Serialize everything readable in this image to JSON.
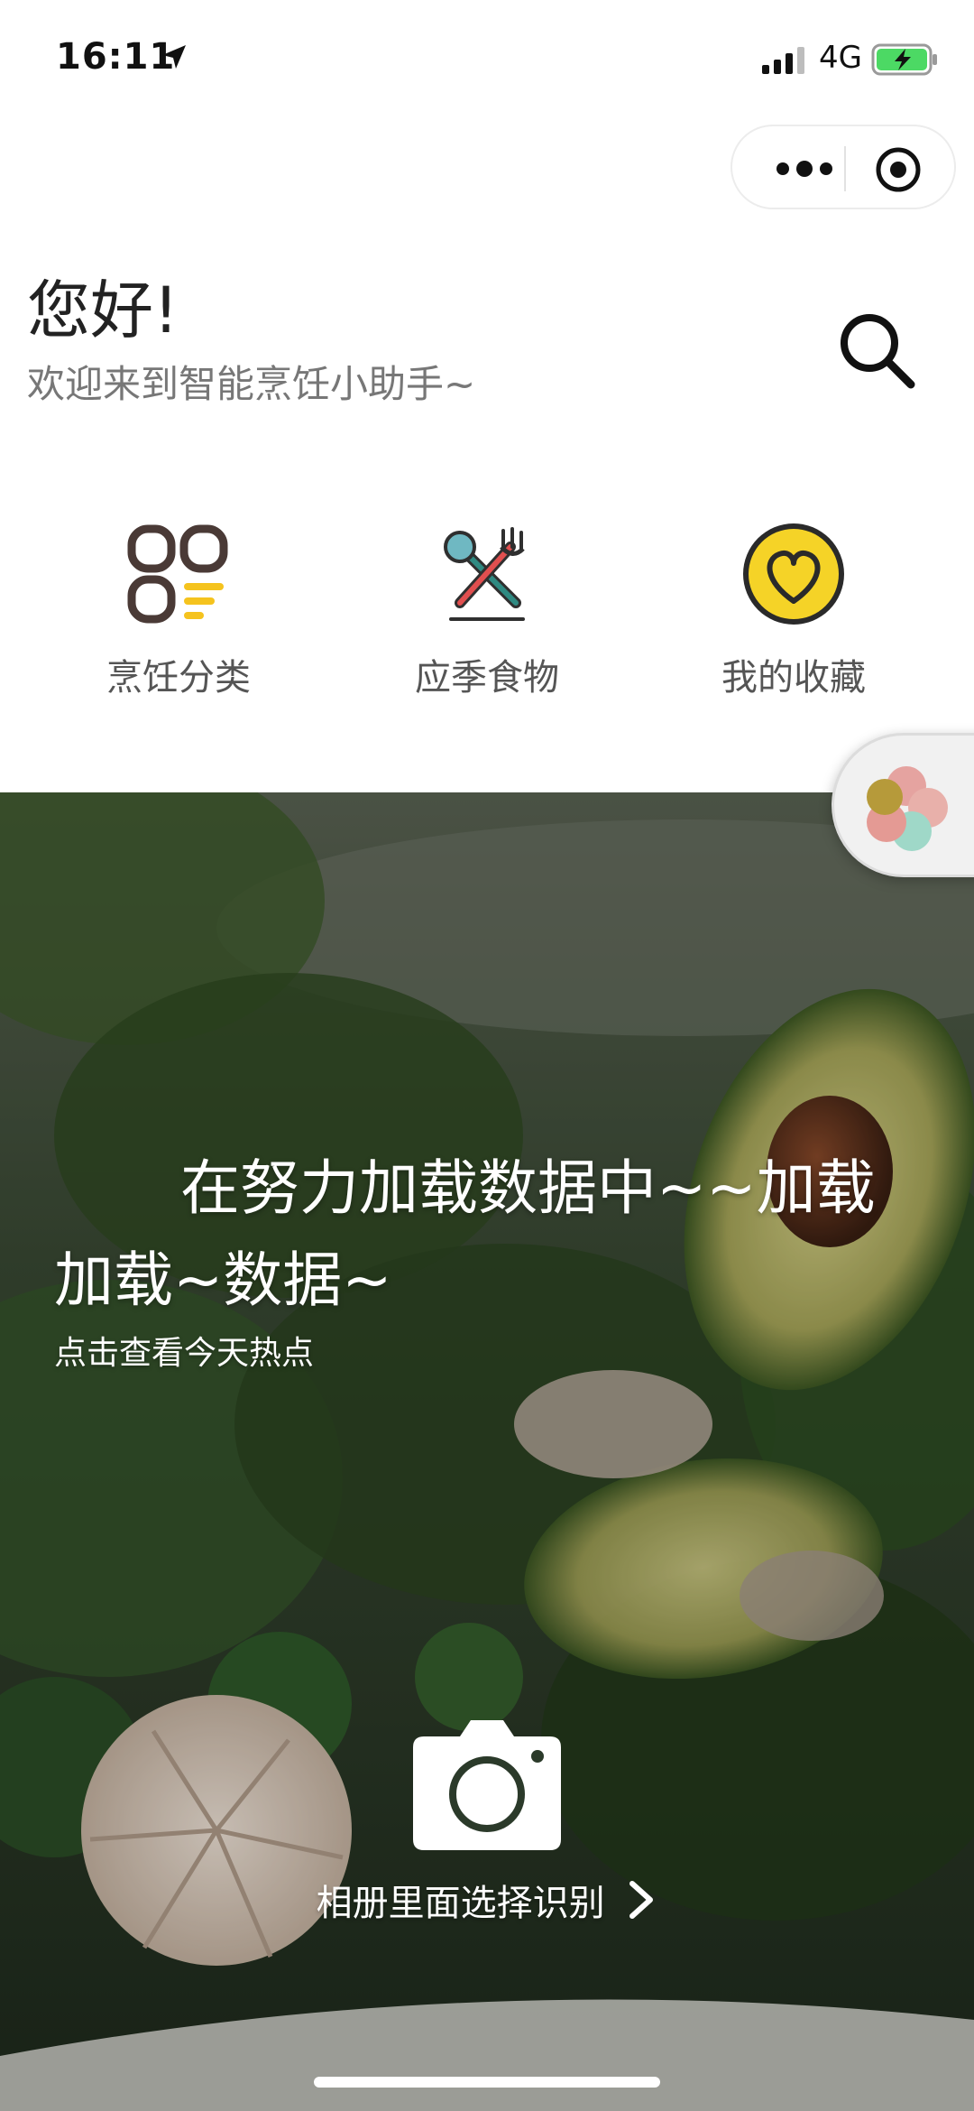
{
  "status_bar": {
    "time": "16:11",
    "network": "4G",
    "location_icon": "location-arrow-icon",
    "signal_icon": "signal-bars-icon",
    "battery_icon": "battery-charging-icon",
    "battery_color": "#4cd964"
  },
  "capsule": {
    "more_icon": "more-dots-icon",
    "close_icon": "target-close-icon"
  },
  "greeting": {
    "title": "您好!",
    "subtitle": "欢迎来到智能烹饪小助手~"
  },
  "search": {
    "icon": "search-icon"
  },
  "nav": [
    {
      "label": "烹饪分类",
      "icon": "category-grid-icon"
    },
    {
      "label": "应季食物",
      "icon": "utensils-icon"
    },
    {
      "label": "我的收藏",
      "icon": "heart-icon"
    }
  ],
  "hero": {
    "headline": "在努力加载数据中~~加载加载~数据~",
    "hot_link": "点击查看今天热点",
    "camera_icon": "camera-icon",
    "album_link": "相册里面选择识别",
    "chevron_icon": "chevron-right-icon"
  },
  "float_button": {
    "icon": "flower-pinwheel-icon"
  },
  "colors": {
    "accent_yellow": "#f5d327",
    "icon_dark": "#4a3a36",
    "icon_teal": "#2f8a82",
    "hero_overlay": "#2b3a2a"
  }
}
